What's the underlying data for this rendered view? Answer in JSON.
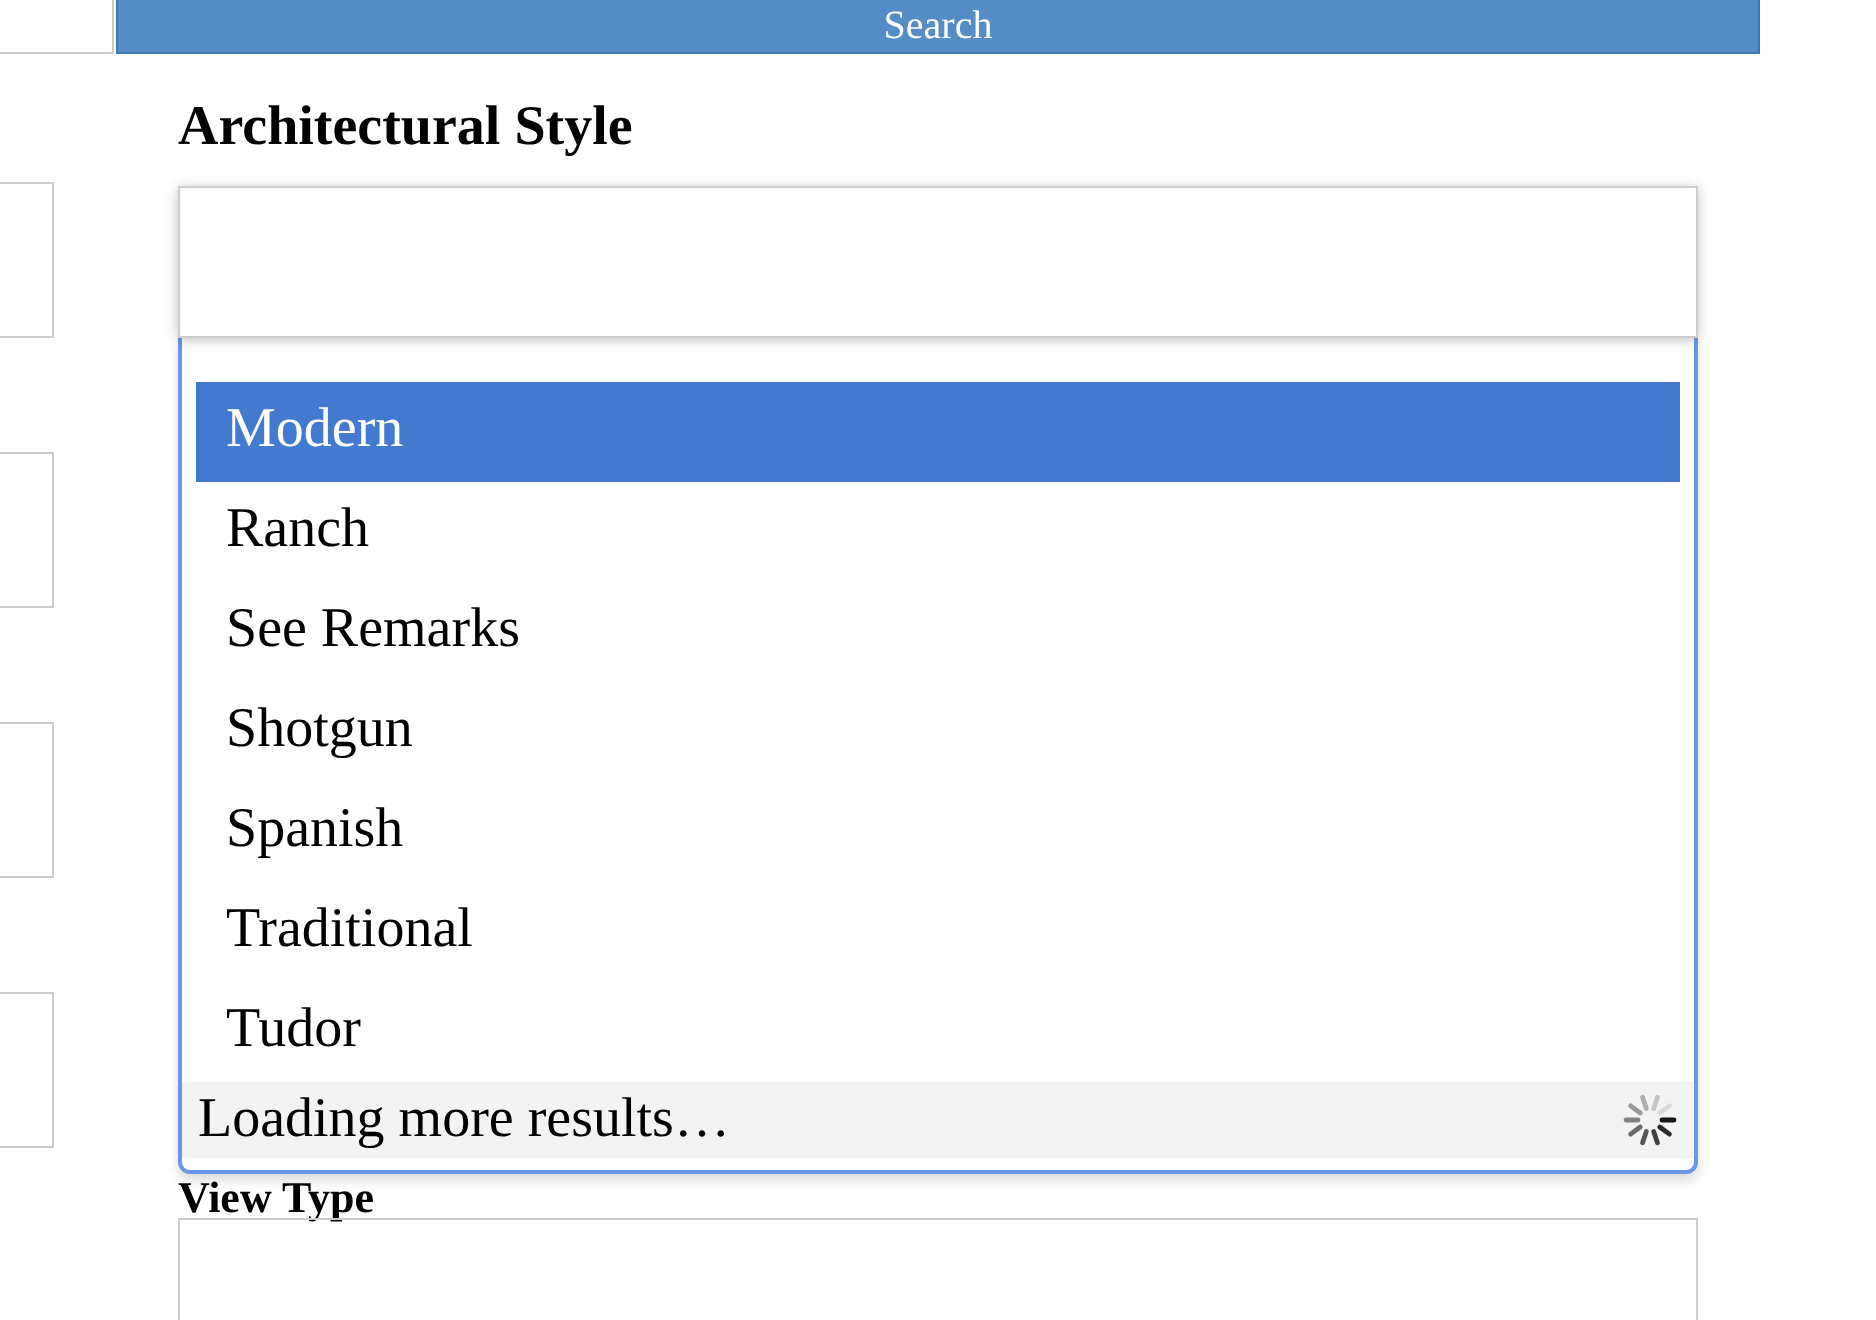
{
  "search_button": {
    "label": "Search"
  },
  "architectural_style": {
    "label": "Architectural Style",
    "options": [
      {
        "label": "Modern",
        "selected": true
      },
      {
        "label": "Ranch",
        "selected": false
      },
      {
        "label": "See Remarks",
        "selected": false
      },
      {
        "label": "Shotgun",
        "selected": false
      },
      {
        "label": "Spanish",
        "selected": false
      },
      {
        "label": "Traditional",
        "selected": false
      },
      {
        "label": "Tudor",
        "selected": false
      }
    ],
    "loading": {
      "text": "Loading more results…"
    }
  },
  "view_type": {
    "label": "View Type"
  }
}
